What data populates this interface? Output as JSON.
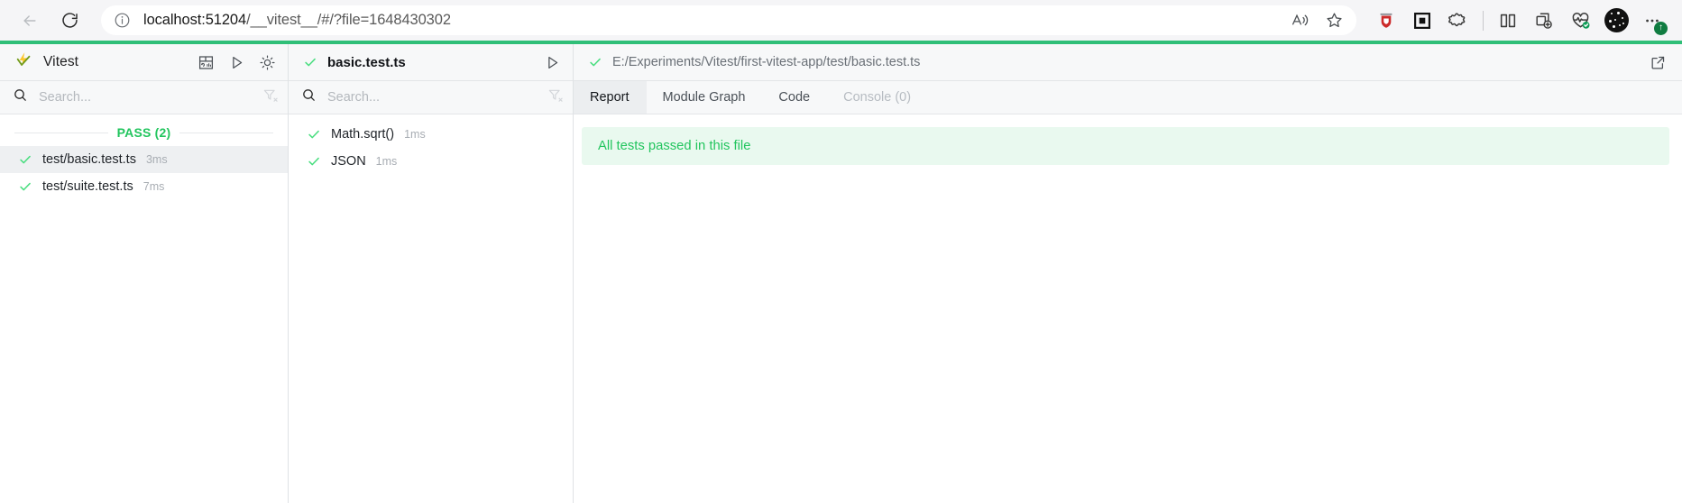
{
  "browser": {
    "back_icon": "back-arrow-icon",
    "reload_icon": "reload-icon",
    "info_icon": "info-circle-icon",
    "url_host": "localhost:51204",
    "url_path": "/__vitest__/#/?file=1648430302",
    "url_full": "localhost:51204/__vitest__/#/?file=1648430302",
    "read_aloud_icon": "read-aloud-icon",
    "favorite_icon": "star-icon",
    "extensions": [
      {
        "name": "ublock-origin-extension-icon",
        "color": "#cc2a2a"
      },
      {
        "name": "dark-reader-extension-icon",
        "color": "#111111"
      },
      {
        "name": "extensions-puzzle-icon",
        "color": "#3b3b3b"
      },
      {
        "name": "split-screen-icon",
        "color": "#3b3b3b"
      },
      {
        "name": "collections-add-icon",
        "color": "#3b3b3b"
      },
      {
        "name": "browser-essentials-icon",
        "color": "#3b3b3b"
      }
    ],
    "profile_icon": "profile-avatar",
    "settings_more_icon": "more-options-icon",
    "update_badge": "↑"
  },
  "app": {
    "accent_green": "#30bf78",
    "brand": "Vitest",
    "logo_icon": "vitest-logo-icon",
    "header_actions": [
      {
        "name": "dashboard-layout-icon",
        "label": "Layout"
      },
      {
        "name": "run-all-icon",
        "label": "Run all"
      },
      {
        "name": "theme-toggle-sun-icon",
        "label": "Toggle theme"
      }
    ]
  },
  "left_pane": {
    "search": {
      "placeholder": "Search...",
      "value": "",
      "search_icon": "search-icon",
      "filter_icon": "filter-off-icon"
    },
    "group": {
      "label": "PASS (2)",
      "color": "#22c55e"
    },
    "files": [
      {
        "name": "test/basic.test.ts",
        "time": "3ms",
        "status": "pass",
        "active": true
      },
      {
        "name": "test/suite.test.ts",
        "time": "7ms",
        "status": "pass",
        "active": false
      }
    ]
  },
  "mid_pane": {
    "title": "basic.test.ts",
    "status": "pass",
    "run_icon": "run-file-icon",
    "search": {
      "placeholder": "Search...",
      "value": "",
      "search_icon": "search-icon",
      "filter_icon": "filter-off-icon"
    },
    "tests": [
      {
        "name": "Math.sqrt()",
        "time": "1ms",
        "status": "pass"
      },
      {
        "name": "JSON",
        "time": "1ms",
        "status": "pass"
      }
    ]
  },
  "right_pane": {
    "file_path": "E:/Experiments/Vitest/first-vitest-app/test/basic.test.ts",
    "status": "pass",
    "open_external_icon": "open-in-editor-icon",
    "tabs": [
      {
        "label": "Report",
        "active": true,
        "disabled": false
      },
      {
        "label": "Module Graph",
        "active": false,
        "disabled": false
      },
      {
        "label": "Code",
        "active": false,
        "disabled": false
      },
      {
        "label": "Console (0)",
        "active": false,
        "disabled": true
      }
    ],
    "banner": {
      "text": "All tests passed in this file",
      "color": "#22c55e",
      "background": "#e9f9ef"
    }
  }
}
